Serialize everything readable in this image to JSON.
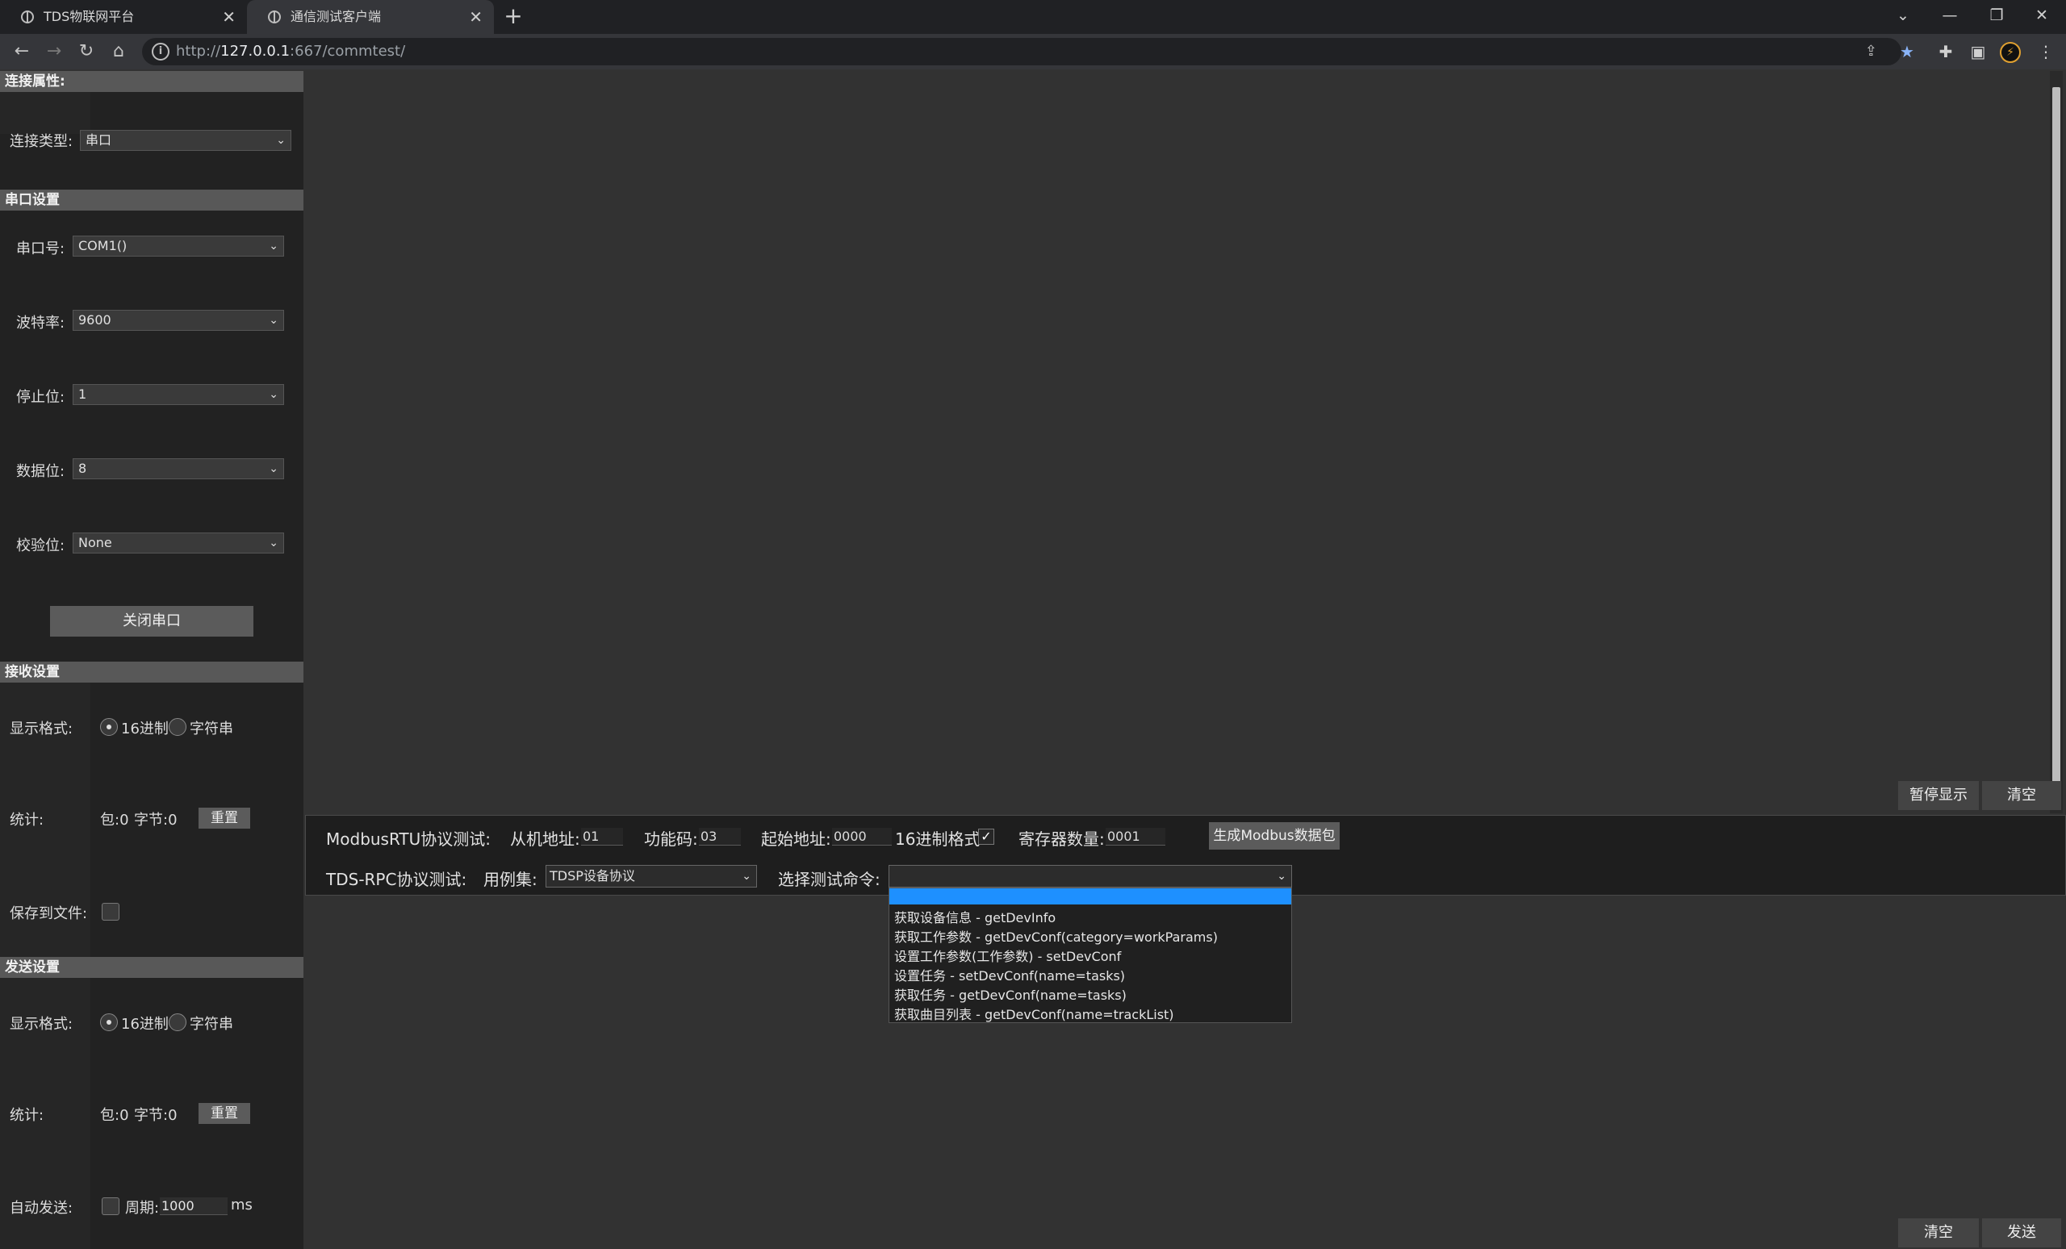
{
  "browser": {
    "tabs": [
      {
        "title": "TDS物联网平台"
      },
      {
        "title": "通信测试客户端"
      }
    ],
    "url_prefix": "http://",
    "url_host": "127.0.0.1",
    "url_rest": ":667/commtest/"
  },
  "sidebar": {
    "conn": {
      "header": "连接属性:",
      "type_label": "连接类型:",
      "type_value": "串口"
    },
    "serial": {
      "header": "串口设置",
      "port_label": "串口号:",
      "port_value": "COM1()",
      "baud_label": "波特率:",
      "baud_value": "9600",
      "stop_label": "停止位:",
      "stop_value": "1",
      "data_label": "数据位:",
      "data_value": "8",
      "parity_label": "校验位:",
      "parity_value": "None",
      "close_button": "关闭串口"
    },
    "recv": {
      "header": "接收设置",
      "format_label": "显示格式:",
      "hex_label": "16进制",
      "str_label": "字符串",
      "stats_label": "统计:",
      "pkt": "包:0",
      "bytes": "字节:0",
      "reset_button": "重置",
      "save_label": "保存到文件:"
    },
    "send": {
      "header": "发送设置",
      "format_label": "显示格式:",
      "hex_label": "16进制",
      "str_label": "字符串",
      "stats_label": "统计:",
      "pkt": "包:0",
      "bytes": "字节:0",
      "reset_button": "重置",
      "auto_label": "自动发送:",
      "period_label": "周期:",
      "period_value": "1000",
      "period_unit": "ms"
    }
  },
  "display": {
    "pause_button": "暂停显示",
    "clear_button": "清空"
  },
  "modbus": {
    "title": "ModbusRTU协议测试:",
    "slave_label": "从机地址:",
    "slave_value": "01",
    "func_label": "功能码:",
    "func_value": "03",
    "start_label": "起始地址:",
    "start_value": "0000",
    "hex_label": "16进制格式",
    "count_label": "寄存器数量:",
    "count_value": "0001",
    "gen_button": "生成Modbus数据包"
  },
  "rpc": {
    "title": "TDS-RPC协议测试:",
    "case_label": "用例集:",
    "case_value": "TDSP设备协议",
    "cmd_label": "选择测试命令:",
    "cmd_options": [
      "获取设备信息 - getDevInfo",
      "获取工作参数 - getDevConf(category=workParams)",
      "设置工作参数(工作参数) - setDevConf",
      "设置任务 - setDevConf(name=tasks)",
      "获取任务 - getDevConf(name=tasks)",
      "获取曲目列表 - getDevConf(name=trackList)"
    ]
  },
  "sendarea": {
    "clear_button": "清空",
    "send_button": "发送"
  }
}
